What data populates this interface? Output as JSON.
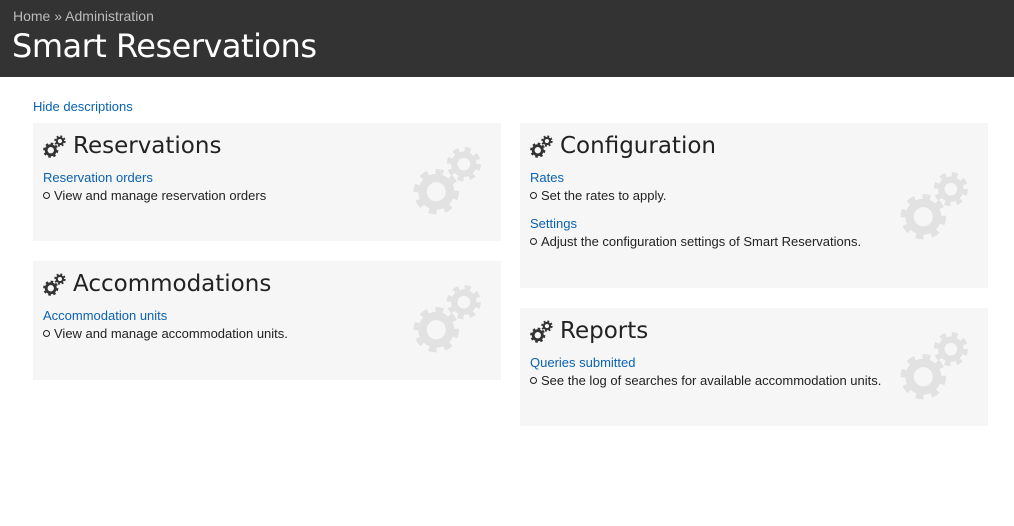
{
  "breadcrumb": {
    "home": "Home",
    "sep": "»",
    "admin": "Administration"
  },
  "page_title": "Smart Reservations",
  "hide_descriptions": "Hide descriptions",
  "panels": [
    {
      "title": "Reservations",
      "items": [
        {
          "link": "Reservation orders",
          "desc": "View and manage reservation orders"
        }
      ]
    },
    {
      "title": "Accommodations",
      "items": [
        {
          "link": "Accommodation units",
          "desc": "View and manage accommodation units."
        }
      ]
    },
    {
      "title": "Configuration",
      "items": [
        {
          "link": "Rates",
          "desc": "Set the rates to apply."
        },
        {
          "link": "Settings",
          "desc": "Adjust the configuration settings of Smart Reservations."
        }
      ]
    },
    {
      "title": "Reports",
      "items": [
        {
          "link": "Queries submitted",
          "desc": "See the log of searches for available accommodation units."
        }
      ]
    }
  ]
}
